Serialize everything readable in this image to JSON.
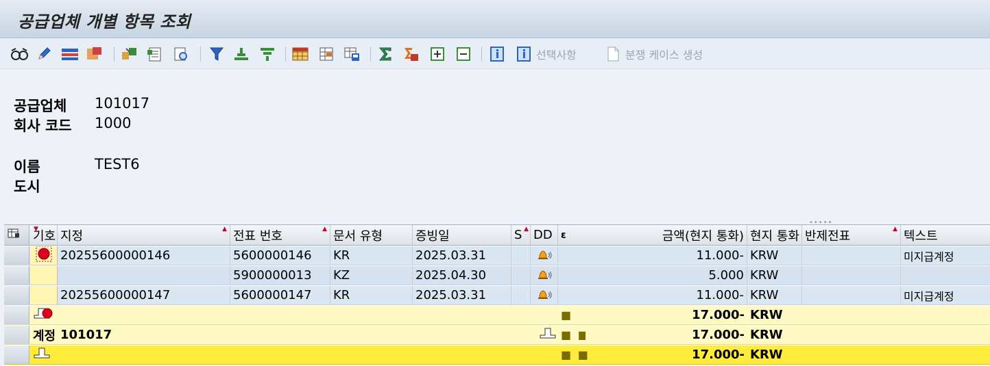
{
  "window": {
    "title": "공급업체 개별 항목 조회"
  },
  "toolbar": {
    "icons": [
      "glasses-icon",
      "pencil-icon",
      "columns-icon",
      "highlight-icon",
      "transfer-icon",
      "doc-list-icon",
      "doc-search-icon",
      "filter-icon",
      "sort-asc-icon",
      "sort-desc-icon",
      "grid-layout-icon",
      "grid-insert-icon",
      "grid-save-icon",
      "sum-icon",
      "subtotal-icon",
      "expand-icon",
      "collapse-icon",
      "info-icon",
      "info-selection-icon",
      "document-icon"
    ],
    "selection_label": "선택사항",
    "dispute_label": "분쟁 케이스 생성"
  },
  "header": {
    "vendor_label": "공급업체",
    "vendor_value": "101017",
    "company_label": "회사 코드",
    "company_value": "1000",
    "name_label": "이름",
    "name_value": "TEST6",
    "city_label": "도시",
    "city_value": ""
  },
  "grid": {
    "columns": {
      "status": "기호",
      "assignment": "지정",
      "doc_no": "전표 번호",
      "doc_type": "문서 유형",
      "doc_date": "증빙일",
      "s": "S",
      "dd": "DD",
      "sigma": "ε",
      "amount": "금액(현지 통화)",
      "currency": "현지 통화",
      "clearing": "반제전표",
      "text": "텍스트"
    },
    "rows": [
      {
        "assignment": "20255600000146",
        "doc_no": "5600000146",
        "doc_type": "KR",
        "doc_date": "2025.03.31",
        "amount": "11.000-",
        "currency": "KRW",
        "text": "미지급계정"
      },
      {
        "assignment": "",
        "doc_no": "5900000013",
        "doc_type": "KZ",
        "doc_date": "2025.04.30",
        "amount": "5.000",
        "currency": "KRW",
        "text": ""
      },
      {
        "assignment": "20255600000147",
        "doc_no": "5600000147",
        "doc_type": "KR",
        "doc_date": "2025.03.31",
        "amount": "11.000-",
        "currency": "KRW",
        "text": "미지급계정"
      }
    ],
    "subtotal1": {
      "amount": "17.000-",
      "currency": "KRW",
      "level_dots": "■"
    },
    "subtotal2": {
      "label": "계정",
      "account": "101017",
      "amount": "17.000-",
      "currency": "KRW",
      "level_dots": "■ ■"
    },
    "total": {
      "amount": "17.000-",
      "currency": "KRW",
      "level_dots": "■ ■ ■"
    }
  },
  "colors": {
    "title_bar": "#d0dbe8",
    "row_blue": "#dbe6f3",
    "subtotal_yellow": "#fff9c4",
    "total_yellow": "#ffeb3b",
    "status_red": "#e0001b"
  }
}
